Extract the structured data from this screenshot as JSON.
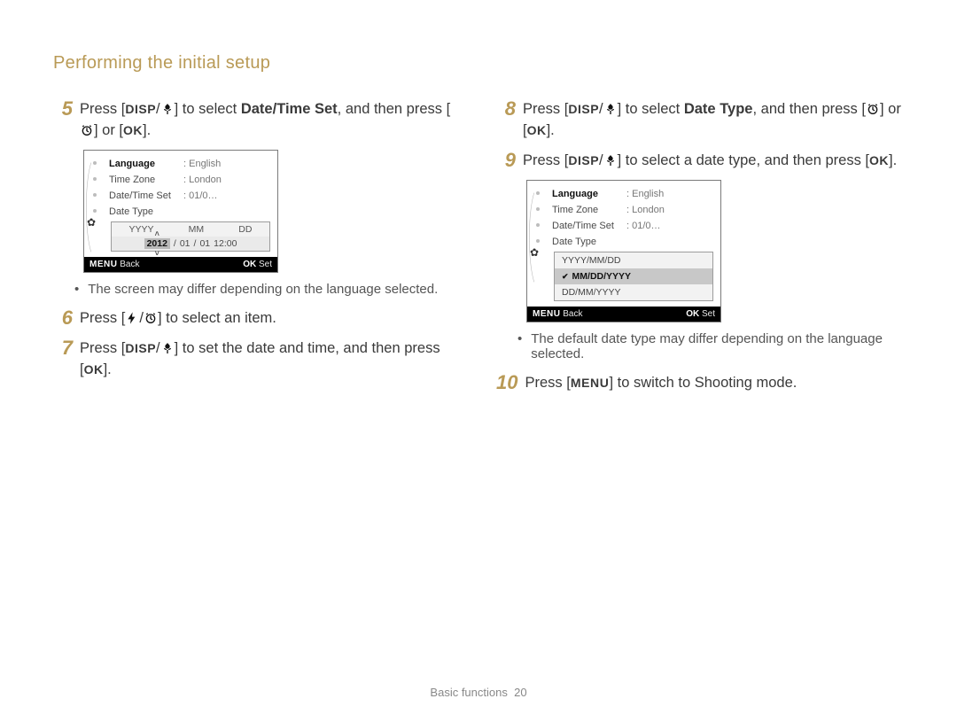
{
  "header": "Performing the initial setup",
  "glyphs": {
    "disp": "DISP",
    "ok": "OK",
    "menu": "MENU"
  },
  "steps": {
    "s5": {
      "num": "5",
      "a": "Press [",
      "b": "] to select ",
      "bold": "Date/Time Set",
      "c": ", and then press [",
      "d": "] or [",
      "e": "]."
    },
    "s6": {
      "num": "6",
      "a": "Press [",
      "b": "] to select an item."
    },
    "s7": {
      "num": "7",
      "a": "Press [",
      "b": "] to set the date and time, and then press [",
      "c": "]."
    },
    "s8": {
      "num": "8",
      "a": "Press [",
      "b": "] to select ",
      "bold": "Date Type",
      "c": ", and then press [",
      "d": "] or [",
      "e": "]."
    },
    "s9": {
      "num": "9",
      "a": "Press [",
      "b": "] to select a date type, and then press [",
      "c": "]."
    },
    "s10": {
      "num": "10",
      "a": "Press [",
      "b": "] to switch to Shooting mode."
    }
  },
  "notes": {
    "n1": "The screen may differ depending on the language selected.",
    "n2": "The default date type may differ depending on the language selected."
  },
  "screen1": {
    "rows": {
      "language": {
        "label": "Language",
        "value": ": English"
      },
      "timezone": {
        "label": "Time Zone",
        "value": ": London"
      },
      "datetimeset": {
        "label": "Date/Time Set",
        "value": ": 01/0…"
      },
      "datetype": {
        "label": "Date Type"
      }
    },
    "popup": {
      "header": {
        "y": "YYYY",
        "m": "MM",
        "d": "DD"
      },
      "year": "2012",
      "sep1": " / ",
      "month": "01",
      "sep2": " / ",
      "day": "01",
      "time": " 12:00"
    },
    "footer": {
      "back": "Back",
      "set": "Set"
    }
  },
  "screen2": {
    "rows": {
      "language": {
        "label": "Language",
        "value": ": English"
      },
      "timezone": {
        "label": "Time Zone",
        "value": ": London"
      },
      "datetimeset": {
        "label": "Date/Time Set",
        "value": ": 01/0…"
      },
      "datetype": {
        "label": "Date Type"
      }
    },
    "popup": {
      "opt1": "YYYY/MM/DD",
      "opt2": "MM/DD/YYYY",
      "opt3": "DD/MM/YYYY"
    },
    "footer": {
      "back": "Back",
      "set": "Set"
    }
  },
  "footer": {
    "section": "Basic functions",
    "page": "20"
  }
}
